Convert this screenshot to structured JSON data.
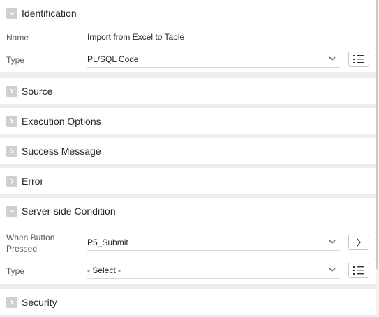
{
  "identification": {
    "title": "Identification",
    "name_label": "Name",
    "name_value": "Import from Excel to Table",
    "type_label": "Type",
    "type_value": "PL/SQL Code"
  },
  "sections_collapsed": {
    "source": "Source",
    "execution_options": "Execution Options",
    "success_message": "Success Message",
    "error": "Error"
  },
  "server_side_condition": {
    "title": "Server-side Condition",
    "when_button_label_line1": "When Button",
    "when_button_label_line2": "Pressed",
    "when_button_value": "P5_Submit",
    "type_label": "Type",
    "type_value": "- Select -"
  },
  "security": {
    "title": "Security"
  },
  "icons": {
    "expanded": "chevron-down-icon",
    "collapsed": "chevron-right-icon",
    "list": "list-icon",
    "go": "chevron-right-icon",
    "select": "chevron-down-icon"
  }
}
